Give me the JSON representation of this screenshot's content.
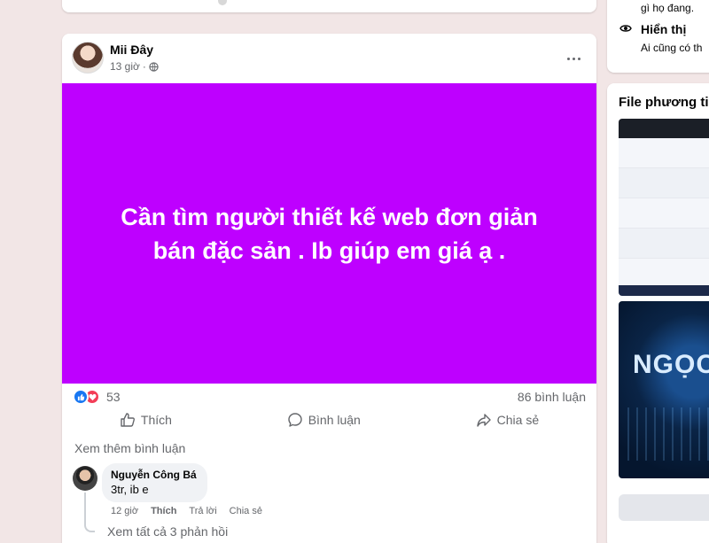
{
  "post": {
    "author": "Mii Đây",
    "time": "13 giờ",
    "text": "Cần tìm người thiết kế web đơn giản bán đặc sản . Ib giúp em giá ạ .",
    "background_color": "#be00ff",
    "reaction_count": "53",
    "comment_count": "86 bình luận",
    "actions": {
      "like": "Thích",
      "comment": "Bình luận",
      "share": "Chia sẻ"
    },
    "more_comments": "Xem thêm bình luận"
  },
  "comment": {
    "author": "Nguyễn Công Bá",
    "text": "3tr, ib e",
    "time": "12 giờ",
    "like": "Thích",
    "reply": "Trả lời",
    "share": "Chia sẻ",
    "view_replies": "Xem tất cả 3 phản hồi"
  },
  "sidebar": {
    "privacy_text_top": "gì họ đang.",
    "visibility_title": "Hiển thị",
    "visibility_desc": "Ai cũng có th",
    "media_title": "File phương tiệ",
    "thumbnail_text": "NGỌC"
  }
}
